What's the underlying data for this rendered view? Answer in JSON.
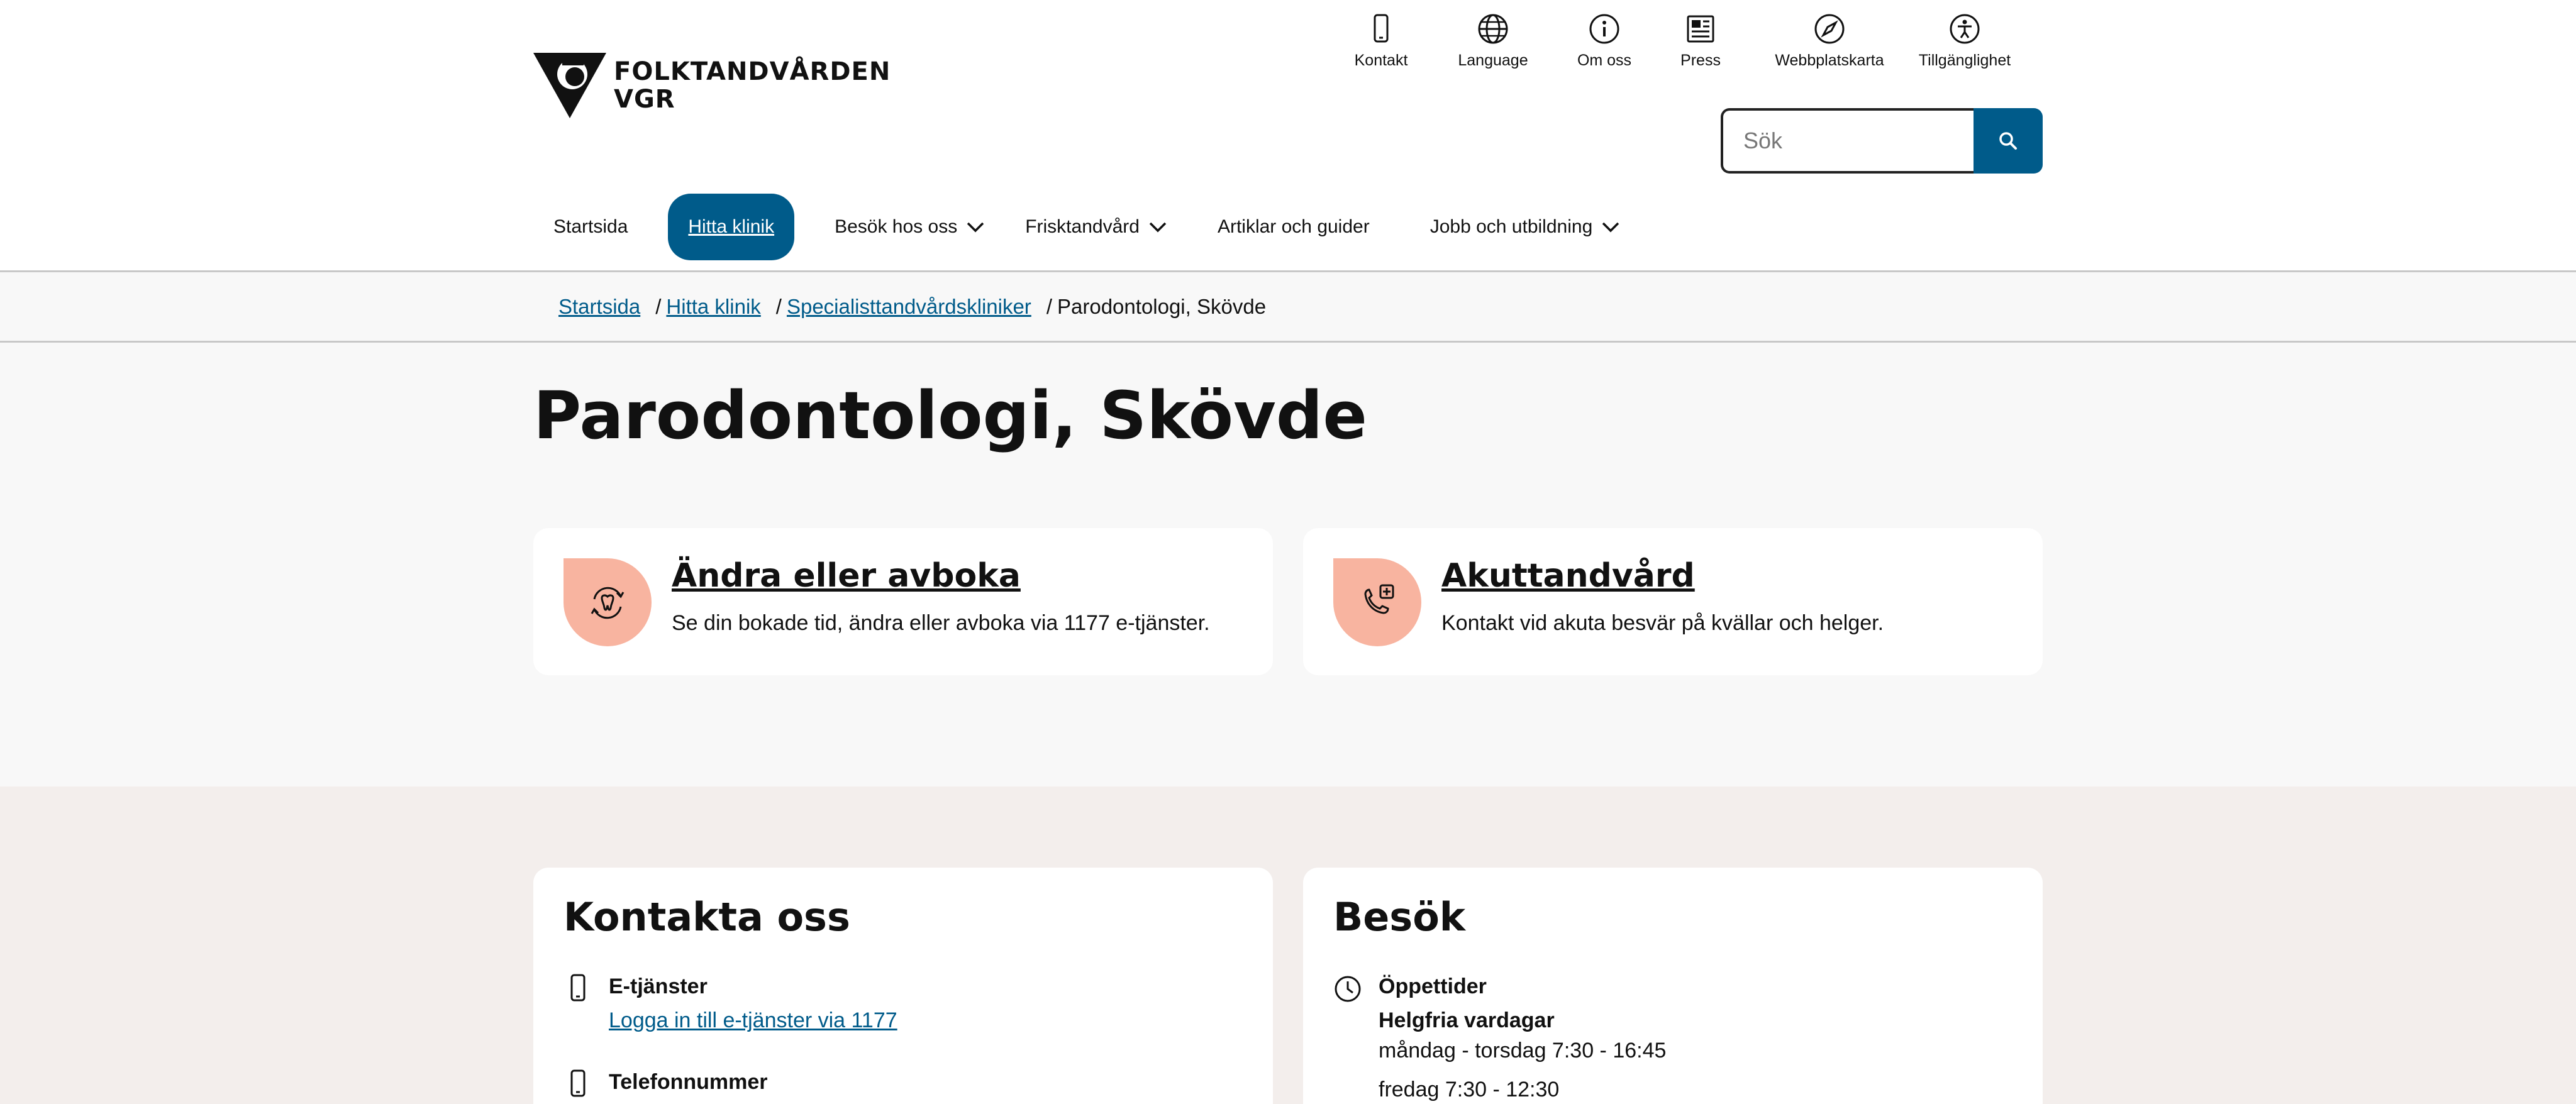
{
  "logo": {
    "line1": "FOLKTANDVÅRDEN",
    "line2": "VGR"
  },
  "utility": [
    {
      "label": "Kontakt",
      "icon": "phone-icon"
    },
    {
      "label": "Language",
      "icon": "globe-icon"
    },
    {
      "label": "Om oss",
      "icon": "info-icon"
    },
    {
      "label": "Press",
      "icon": "newspaper-icon"
    },
    {
      "label": "Webbplatskarta",
      "icon": "compass-icon"
    },
    {
      "label": "Tillgänglighet",
      "icon": "accessibility-icon"
    }
  ],
  "search": {
    "placeholder": "Sök",
    "value": ""
  },
  "nav": [
    {
      "label": "Startsida",
      "active": false,
      "dropdown": false
    },
    {
      "label": "Hitta klinik",
      "active": true,
      "dropdown": false
    },
    {
      "label": "Besök hos oss",
      "active": false,
      "dropdown": true
    },
    {
      "label": "Frisktandvård",
      "active": false,
      "dropdown": true
    },
    {
      "label": "Artiklar och guider",
      "active": false,
      "dropdown": false
    },
    {
      "label": "Jobb och utbildning",
      "active": false,
      "dropdown": true
    }
  ],
  "breadcrumb": {
    "links": [
      "Startsida",
      "Hitta klinik",
      "Specialisttandvårdskliniker"
    ],
    "current": "Parodontologi, Skövde",
    "separator": "/"
  },
  "page": {
    "title": "Parodontologi, Skövde"
  },
  "quick_links": [
    {
      "title": "Ändra eller avboka",
      "description": "Se din bokade tid, ändra eller avboka via 1177 e-tjänster.",
      "icon": "tooth-refresh-icon"
    },
    {
      "title": "Akuttandvård",
      "description": "Kontakt vid akuta besvär på kvällar och helger.",
      "icon": "phone-plus-icon"
    }
  ],
  "contact": {
    "title": "Kontakta oss",
    "etjanster_label": "E-tjänster",
    "etjanster_link": "Logga in till e-tjänster via 1177",
    "phone_label": "Telefonnummer"
  },
  "visit": {
    "title": "Besök",
    "hours_label": "Öppettider",
    "subheading": "Helgfria vardagar",
    "line1": "måndag - torsdag 7:30 - 16:45",
    "line2": "fredag 7:30 - 12:30"
  },
  "colors": {
    "primary": "#005b8a",
    "accent_icon_bg": "#f8b4a0",
    "lower_bg": "#f3eeec"
  }
}
